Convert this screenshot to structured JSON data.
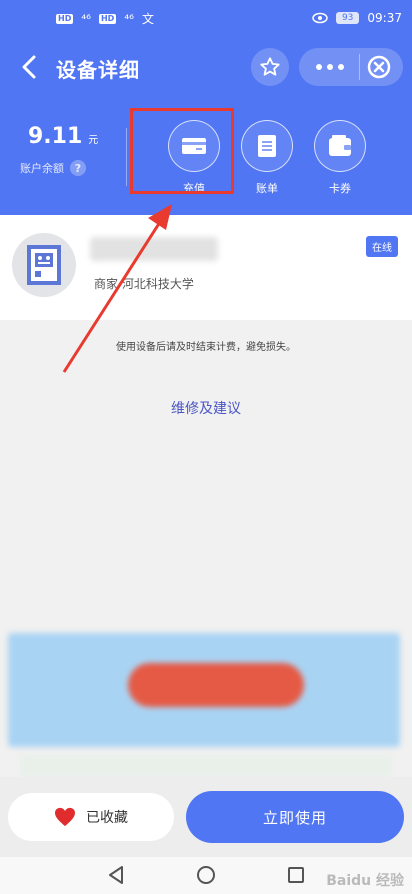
{
  "status": {
    "hd1": "HD",
    "hd2": "HD",
    "signal1": "⁴⁶",
    "signal2": "⁴⁶",
    "extra": "文",
    "battery": "93",
    "time": "09:37"
  },
  "nav": {
    "title": "设备详细"
  },
  "account": {
    "balance": "9.11",
    "unit": "元",
    "label": "账户余额",
    "help": "?"
  },
  "actions": [
    {
      "label": "充值",
      "icon": "card-icon"
    },
    {
      "label": "账单",
      "icon": "bill-icon"
    },
    {
      "label": "卡券",
      "icon": "wallet-icon"
    }
  ],
  "device": {
    "location": "商家  河北科技大学",
    "badge": "在线"
  },
  "notice": "使用设备后请及时结束计费，避免损失。",
  "repair_link": "维修及建议",
  "bottom": {
    "favorite_label": "已收藏",
    "use_label": "立即使用"
  },
  "watermark": "Baidu 经验",
  "colors": {
    "primary": "#5176f3",
    "highlight": "#e83a2f",
    "favorite": "#e02c2c"
  }
}
